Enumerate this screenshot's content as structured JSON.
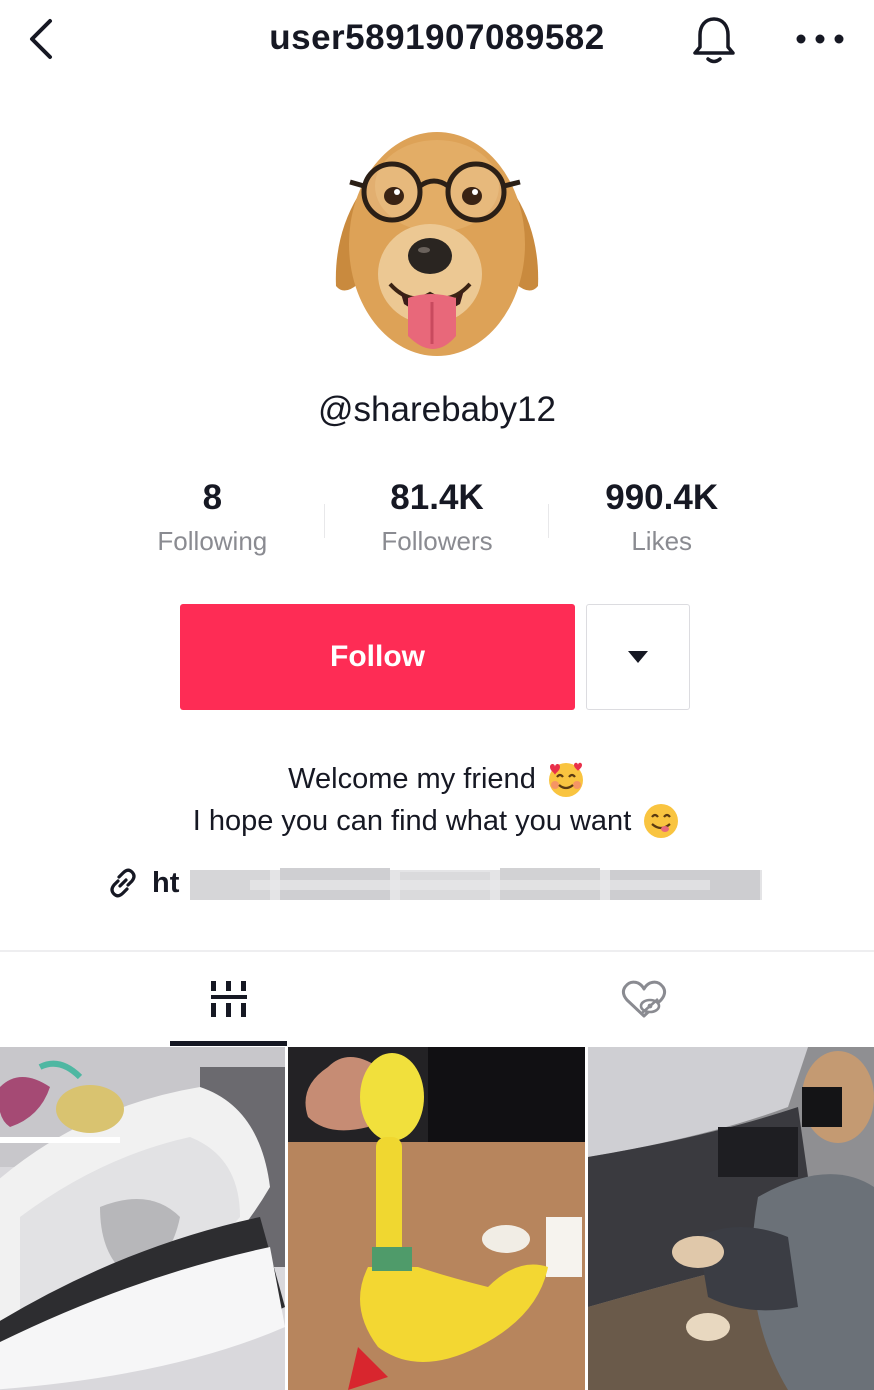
{
  "header": {
    "title": "user5891907089582",
    "icons": {
      "back": "chevron-left-icon",
      "bell": "bell-icon",
      "more": "more-horizontal-icon"
    }
  },
  "profile": {
    "handle": "@sharebaby12",
    "stats": [
      {
        "value": "8",
        "label": "Following"
      },
      {
        "value": "81.4K",
        "label": "Followers"
      },
      {
        "value": "990.4K",
        "label": "Likes"
      }
    ],
    "follow_label": "Follow",
    "bio_line1": "Welcome my friend",
    "bio_line2": "I hope you can find what you want",
    "link_prefix": "ht"
  },
  "tabs": [
    {
      "name": "videos",
      "icon": "grid-icon",
      "active": true
    },
    {
      "name": "liked",
      "icon": "liked-private-icon",
      "active": false
    }
  ],
  "colors": {
    "accent": "#fe2c55",
    "text": "#161823",
    "muted": "#8a8b91"
  }
}
